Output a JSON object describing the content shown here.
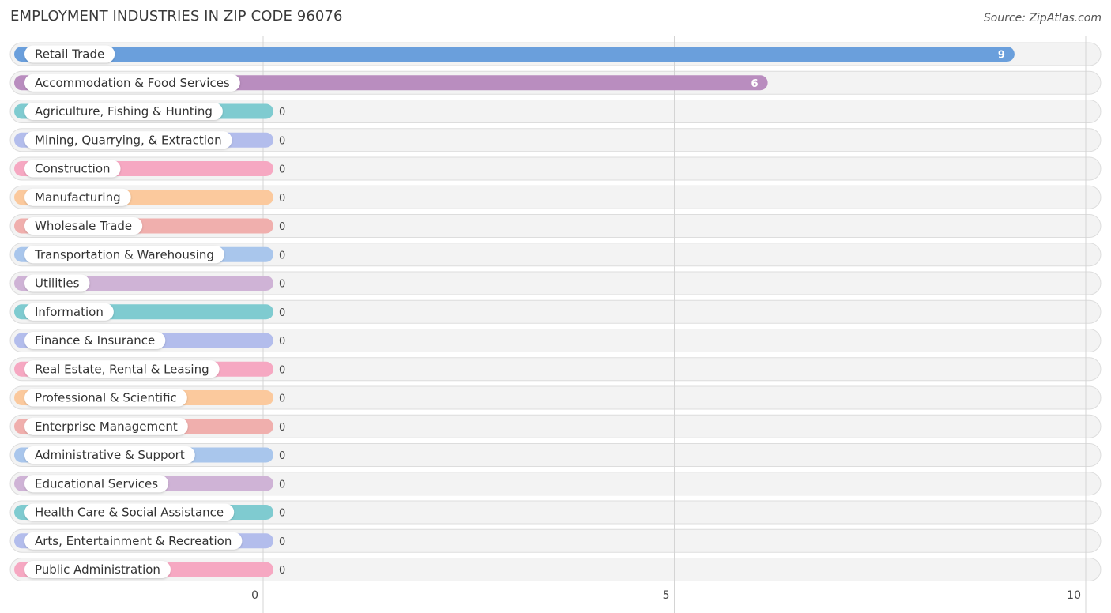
{
  "title": "EMPLOYMENT INDUSTRIES IN ZIP CODE 96076",
  "source": "Source: ZipAtlas.com",
  "chart_data": {
    "type": "bar",
    "orientation": "horizontal",
    "title": "EMPLOYMENT INDUSTRIES IN ZIP CODE 96076",
    "xlabel": "",
    "ylabel": "",
    "xlim": [
      0,
      10
    ],
    "xticks": [
      0,
      5,
      10
    ],
    "grid": true,
    "categories": [
      "Retail Trade",
      "Accommodation & Food Services",
      "Agriculture, Fishing & Hunting",
      "Mining, Quarrying, & Extraction",
      "Construction",
      "Manufacturing",
      "Wholesale Trade",
      "Transportation & Warehousing",
      "Utilities",
      "Information",
      "Finance & Insurance",
      "Real Estate, Rental & Leasing",
      "Professional & Scientific",
      "Enterprise Management",
      "Administrative & Support",
      "Educational Services",
      "Health Care & Social Assistance",
      "Arts, Entertainment & Recreation",
      "Public Administration"
    ],
    "values": [
      9,
      6,
      0,
      0,
      0,
      0,
      0,
      0,
      0,
      0,
      0,
      0,
      0,
      0,
      0,
      0,
      0,
      0,
      0
    ],
    "colors": [
      "#6a9fdc",
      "#b98dbf",
      "#7fcbd0",
      "#b3bdec",
      "#f6a8c2",
      "#fbc99d",
      "#f0afad",
      "#a9c6ec",
      "#cfb3d6",
      "#7fcbd0",
      "#b3bdec",
      "#f6a8c2",
      "#fbc99d",
      "#f0afad",
      "#a9c6ec",
      "#cfb3d6",
      "#7fcbd0",
      "#b3bdec",
      "#f6a8c2"
    ]
  }
}
